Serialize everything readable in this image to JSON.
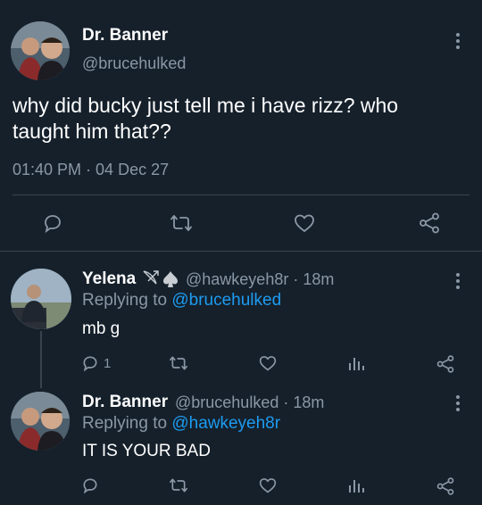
{
  "main_tweet": {
    "display_name": "Dr. Banner",
    "handle": "@brucehulked",
    "text_line1": "why did bucky just tell me i have rizz? who",
    "text_line2": "taught him that??",
    "timestamp": "01:40 PM · 04 Dec 27"
  },
  "replies": [
    {
      "display_name": "Yelena",
      "handle_time": "@hawkeyeh8r · 18m",
      "replying_prefix": "Replying to ",
      "replying_to": "@brucehulked",
      "text": "mb g",
      "reply_count": "1"
    },
    {
      "display_name": "Dr. Banner",
      "handle_time": "@brucehulked · 18m",
      "replying_prefix": "Replying to ",
      "replying_to": "@hawkeyeh8r",
      "text": "IT IS YOUR BAD"
    }
  ],
  "colors": {
    "background": "#15202b",
    "muted": "#8b98a5",
    "link": "#1d9bf0",
    "divider": "#38444d"
  },
  "icons": [
    "reply-icon",
    "retweet-icon",
    "like-icon",
    "share-icon",
    "analytics-icon",
    "more-icon",
    "bow-arrow-emoji",
    "spade-emoji"
  ]
}
